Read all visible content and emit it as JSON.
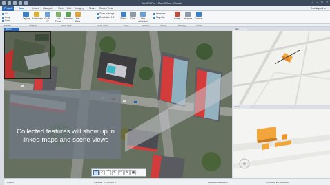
{
  "titlebar": {
    "title": "ArcGIS Pro - MainOffice - Mosaic",
    "window_controls": [
      "?",
      "–",
      "□",
      "×"
    ]
  },
  "tabs": [
    {
      "label": "Project"
    },
    {
      "label": "Map"
    },
    {
      "label": "Insert"
    },
    {
      "label": "Analysis"
    },
    {
      "label": "View"
    },
    {
      "label": "Edit"
    },
    {
      "label": "Imagery"
    },
    {
      "label": "Share"
    },
    {
      "label": "Stereo View"
    }
  ],
  "signin": "Not signed in",
  "ribbon": {
    "buttons": [
      {
        "label": "Explore",
        "icon": "explore-icon"
      },
      {
        "label": "Bookmarks",
        "icon": "bookmark-icon"
      },
      {
        "label": "Go To XY",
        "icon": "goto-icon"
      },
      {
        "label": "Add Preset",
        "icon": "preset-icon"
      },
      {
        "label": "Basemap",
        "icon": "basemap-icon"
      },
      {
        "label": "Add Data",
        "icon": "add-data-icon"
      },
      {
        "label": "Select",
        "icon": "select-icon"
      },
      {
        "label": "Clear",
        "icon": "clear-icon"
      },
      {
        "label": "Infer Attributes",
        "icon": "attributes-icon"
      },
      {
        "label": "Locate",
        "icon": "locate-icon"
      },
      {
        "label": "Measure",
        "icon": "measure-icon"
      },
      {
        "label": "Zoom to",
        "icon": "zoom-icon"
      }
    ],
    "small": [
      "Cut",
      "Copy",
      "Paste",
      "Zoom to Image",
      "Resolution: 1:2",
      "Overview",
      "Magnifier"
    ],
    "groups": [
      "Clipboard",
      "Navigate",
      "Stereo Layer",
      "Stereo Mode",
      "Layer",
      "Selection",
      "Inquiry",
      "Labeling",
      "Offline"
    ]
  },
  "view_tab": "Stereo",
  "caption": "Collected features will show up in linked maps and scene views",
  "edit_tools": [
    "▭",
    "∕",
    "⌒",
    "✎",
    "□",
    "✎",
    "▣"
  ],
  "status": {
    "scale": "1:4,000",
    "coords": "0,969402°E 0,464981°N",
    "selected": "Selected Features: 0",
    "right_coords": "0,969402°E 0,464981°N"
  },
  "right_map_tab": "Map",
  "right_scene_tab": "Scene"
}
